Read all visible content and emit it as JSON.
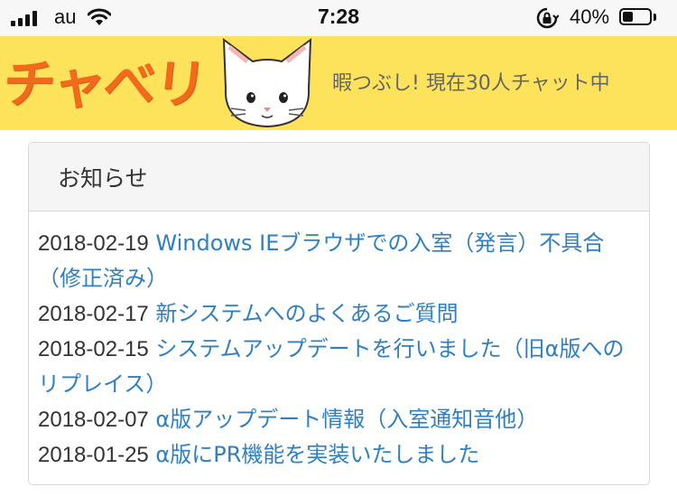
{
  "status_bar": {
    "carrier": "au",
    "time": "7:28",
    "battery_percent_text": "40%",
    "battery_level": 0.4,
    "icons": [
      "signal-icon",
      "wifi-icon",
      "rotation-lock-icon",
      "battery-icon"
    ]
  },
  "header": {
    "logo_text": "チャべリ",
    "tagline": "暇つぶし! 現在30人チャット中",
    "colors": {
      "banner": "#fde25b",
      "logo": "#f26a1b"
    }
  },
  "notice": {
    "title": "お知らせ",
    "link_color": "#2f7fc1",
    "items": [
      {
        "date": "2018-02-19",
        "text": "Windows IEブラウザでの入室（発言）不具合（修正済み）"
      },
      {
        "date": "2018-02-17",
        "text": "新システムへのよくあるご質問"
      },
      {
        "date": "2018-02-15",
        "text": "システムアップデートを行いました（旧α版へのリプレイス）"
      },
      {
        "date": "2018-02-07",
        "text": "α版アップデート情報（入室通知音他）"
      },
      {
        "date": "2018-01-25",
        "text": "α版にPR機能を実装いたしました"
      }
    ]
  }
}
